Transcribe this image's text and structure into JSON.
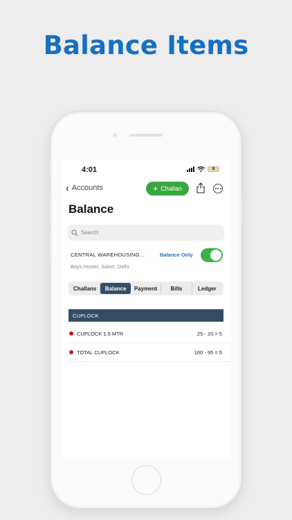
{
  "headline": "Balance Items",
  "status": {
    "time": "4:01",
    "battery": "8"
  },
  "nav": {
    "back_label": "Accounts",
    "challan_label": "Challan"
  },
  "page_title": "Balance",
  "search": {
    "placeholder": "Search"
  },
  "account": {
    "name": "CENTRAL WAREHOUSING...",
    "address": "Boys Hostel, Saket, Delhi"
  },
  "balance_only": {
    "label": "Balance Only",
    "enabled": true
  },
  "tabs": [
    {
      "label": "Challans",
      "active": false
    },
    {
      "label": "Balance",
      "active": true
    },
    {
      "label": "Payment",
      "active": false
    },
    {
      "label": "Bills",
      "active": false
    },
    {
      "label": "Ledger",
      "active": false
    }
  ],
  "group": {
    "title": "CUPLOCK"
  },
  "items": [
    {
      "name": "CUPLOCK 1.5 MTR",
      "value": "25 - 20 = 5"
    },
    {
      "name": "TOTAL CUPLOCK",
      "value": "100 - 95 = 5"
    }
  ],
  "colors": {
    "brand": "#1670c2",
    "accent_green": "#3aa63f",
    "header_navy": "#344c66",
    "dot_red": "#c21b1b"
  }
}
